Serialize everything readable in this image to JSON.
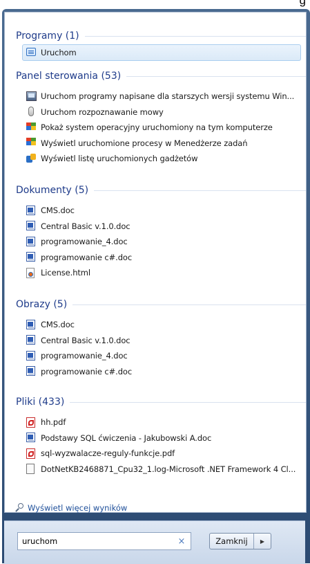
{
  "top_text": "g",
  "sections": [
    {
      "key": "programy",
      "header": "Programy (1)",
      "items": [
        {
          "label": "Uruchom",
          "icon": "run-icon",
          "selected": true
        }
      ]
    },
    {
      "key": "panel",
      "header": "Panel sterowania (53)",
      "items": [
        {
          "label": "Uruchom programy napisane dla starszych wersji systemu Win...",
          "icon": "compat-icon"
        },
        {
          "label": "Uruchom rozpoznawanie mowy",
          "icon": "microphone-icon"
        },
        {
          "label": "Pokaż system operacyjny uruchomiony na tym komputerze",
          "icon": "system-flag-icon"
        },
        {
          "label": "Wyświetl uruchomione procesy w Menedżerze zadań",
          "icon": "task-manager-icon"
        },
        {
          "label": "Wyświetl listę uruchomionych gadżetów",
          "icon": "gadget-icon"
        }
      ]
    },
    {
      "key": "dokumenty",
      "header": "Dokumenty (5)",
      "items": [
        {
          "label": "CMS.doc",
          "icon": "word-doc-icon"
        },
        {
          "label": "Central Basic v.1.0.doc",
          "icon": "word-doc-icon"
        },
        {
          "label": "programowanie_4.doc",
          "icon": "word-doc-icon"
        },
        {
          "label": "programowanie c#.doc",
          "icon": "word-doc-icon"
        },
        {
          "label": "License.html",
          "icon": "html-file-icon"
        }
      ]
    },
    {
      "key": "obrazy",
      "header": "Obrazy (5)",
      "items": [
        {
          "label": "CMS.doc",
          "icon": "word-doc-icon"
        },
        {
          "label": "Central Basic v.1.0.doc",
          "icon": "word-doc-icon"
        },
        {
          "label": "programowanie_4.doc",
          "icon": "word-doc-icon"
        },
        {
          "label": "programowanie c#.doc",
          "icon": "word-doc-icon"
        }
      ]
    },
    {
      "key": "pliki",
      "header": "Pliki (433)",
      "items": [
        {
          "label": "hh.pdf",
          "icon": "pdf-icon"
        },
        {
          "label": "Podstawy SQL ćwiczenia - Jakubowski A.doc",
          "icon": "word-doc-icon"
        },
        {
          "label": "sql-wyzwalacze-reguly-funkcje.pdf",
          "icon": "pdf-icon"
        },
        {
          "label": "DotNetKB2468871_Cpu32_1.log-Microsoft .NET Framework 4 Cl...",
          "icon": "log-file-icon"
        }
      ]
    }
  ],
  "more_results": "Wyświetl więcej wyników",
  "search": {
    "value": "uruchom",
    "clear_glyph": "×"
  },
  "close_button": {
    "label": "Zamknij",
    "arrow": "▶"
  },
  "colors": {
    "header": "#1e3b8a",
    "link": "#1e4f9a",
    "frame": "#2b4a72"
  }
}
